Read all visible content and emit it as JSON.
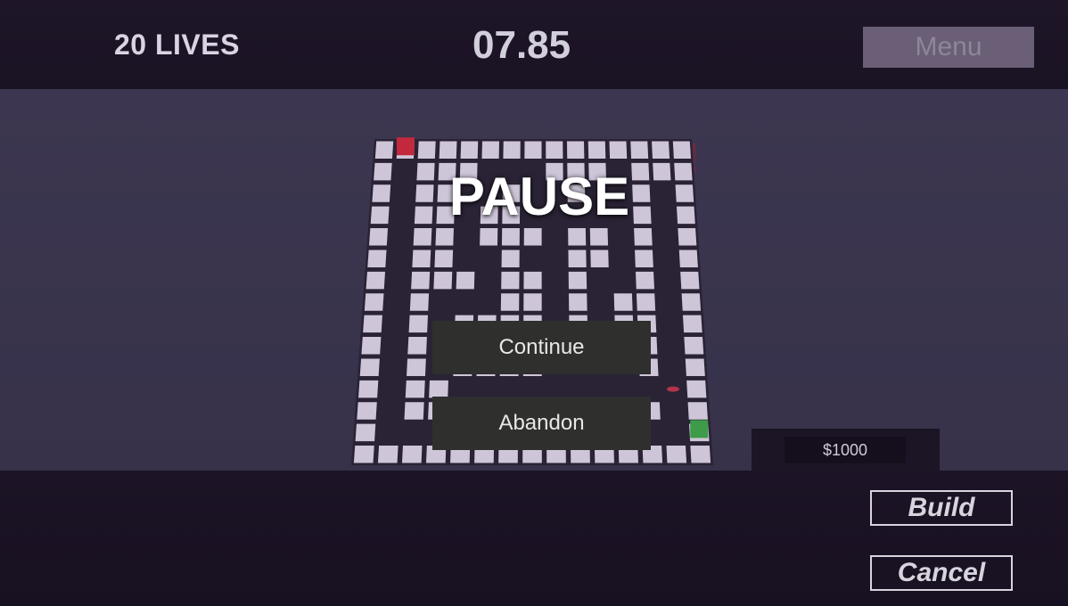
{
  "hud": {
    "lives_text": "20 LIVES",
    "timer_text": "07.85",
    "menu_label": "Menu"
  },
  "pause_menu": {
    "title": "PAUSE",
    "continue_label": "Continue",
    "abandon_label": "Abandon"
  },
  "shop": {
    "money": "$1000",
    "build_label": "Build",
    "cancel_label": "Cancel"
  },
  "colors": {
    "tile": "#cec6d8",
    "path": "#2a2335",
    "start_marker": "#c4283c",
    "goal_marker": "#3d9b4a",
    "enemy": "#b33348"
  },
  "maze": {
    "cols": 15,
    "rows": 15,
    "grid": [
      "#S#############",
      "#.###...###.###",
      "#.##..#..#..#.#",
      "#.##.##.....#.#",
      "#.##.###.##.#.#",
      "#.##..#..##.#.#",
      "#.###.##.#..#.#",
      "#.#...##.#.##.#",
      "#.#.####.#.##.#",
      "#.#....###..#.#",
      "#.#.####....#.#",
      "#.##.........E#",
      "#.###########.#",
      "#.............G",
      "###############"
    ],
    "icons": {
      "start": "red-spawn-cube-icon",
      "goal": "green-goal-cube-icon",
      "enemy": "enemy-icon"
    }
  }
}
